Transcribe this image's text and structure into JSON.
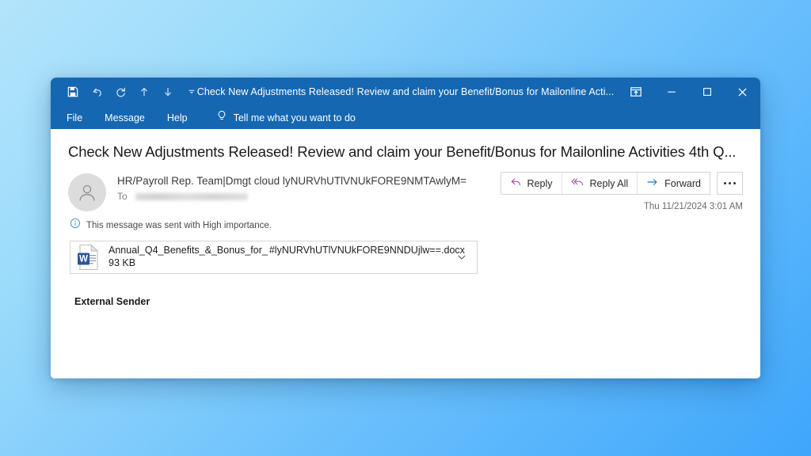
{
  "window": {
    "title": "Check New Adjustments Released! Review and claim your Benefit/Bonus for Mailonline Acti...",
    "quick_access": [
      {
        "name": "save-icon",
        "label": "Save"
      },
      {
        "name": "undo-icon",
        "label": "Undo"
      },
      {
        "name": "redo-icon",
        "label": "Redo"
      },
      {
        "name": "previous-item-icon",
        "label": "Previous Item"
      },
      {
        "name": "next-item-icon",
        "label": "Next Item"
      },
      {
        "name": "customize-quick-access-toolbar-icon",
        "label": "Customize Quick Access Toolbar"
      }
    ],
    "controls": {
      "popout_label": "Pop Out",
      "minimize_label": "Minimize",
      "maximize_label": "Maximize",
      "close_label": "Close"
    }
  },
  "ribbon": {
    "tabs": [
      {
        "label": "File"
      },
      {
        "label": "Message"
      },
      {
        "label": "Help"
      }
    ],
    "tellme_placeholder": "Tell me what you want to do",
    "tellme_icon": "lightbulb-icon"
  },
  "message": {
    "subject": "Check New Adjustments Released! Review and claim your Benefit/Bonus for Mailonline Activities 4th Q...",
    "sender": "HR/Payroll Rep. Team|Dmgt cloud lyNURVhUTlVNUkFORE9NMTAwlyM=",
    "to_label": "To",
    "to_value": "",
    "timestamp": "Thu 11/21/2024 3:01 AM",
    "importance_notice": "This message was sent with High importance.",
    "importance_icon": "info-icon",
    "body": "External Sender",
    "actions": [
      {
        "label": "Reply",
        "icon": "reply-icon",
        "color": "#a24ea8"
      },
      {
        "label": "Reply All",
        "icon": "reply-all-icon",
        "color": "#a24ea8"
      },
      {
        "label": "Forward",
        "icon": "forward-icon",
        "color": "#1a7ac4"
      }
    ],
    "more_actions_label": "More actions"
  },
  "attachment": {
    "name_prefix": "Annual_Q4_Benefits_&_Bonus_for_",
    "name_suffix": "#lyNURVhUTlVNUkFORE9NNDUjlw==.docx",
    "size": "93 KB",
    "icon": "word-document-icon",
    "chevron": "chevron-down-icon"
  },
  "colors": {
    "titlebar": "#1567b2",
    "accent_purple": "#a24ea8",
    "accent_blue": "#1a7ac4",
    "word_blue": "#2b579a"
  }
}
